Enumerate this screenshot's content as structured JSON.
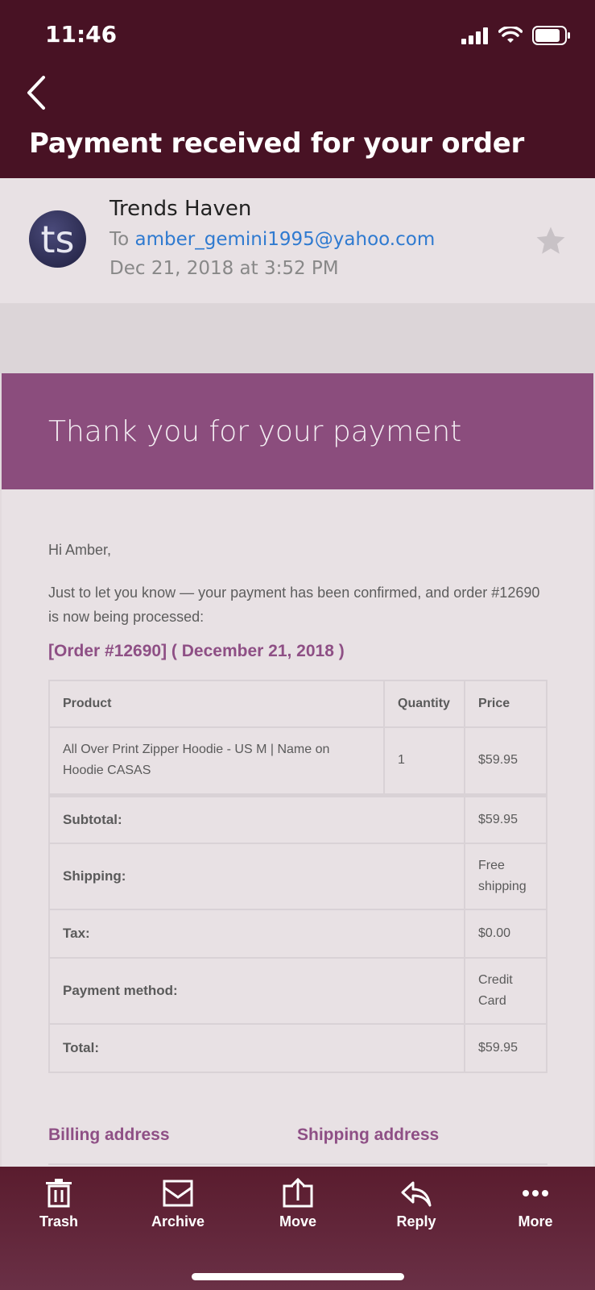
{
  "status": {
    "time": "11:46"
  },
  "nav": {
    "subject": "Payment received for your order"
  },
  "email": {
    "avatar_initials": "ts",
    "sender": "Trends Haven",
    "to_prefix": "To",
    "to_address": "amber_gemini1995@yahoo.com",
    "date": "Dec 21, 2018 at 3:52 PM"
  },
  "body": {
    "banner": "Thank you for your payment",
    "greeting": "Hi Amber,",
    "intro": "Just to let you know — your payment has been confirmed, and order #12690 is now being processed:",
    "order_heading": "[Order #12690] ( December 21, 2018 )",
    "table": {
      "headers": [
        "Product",
        "Quantity",
        "Price"
      ],
      "item": {
        "product": "All Over Print Zipper Hoodie - US M | Name on Hoodie CASAS",
        "quantity": "1",
        "price": "$59.95"
      },
      "totals": [
        {
          "label": "Subtotal:",
          "value": "$59.95"
        },
        {
          "label": "Shipping:",
          "value": "Free shipping"
        },
        {
          "label": "Tax:",
          "value": "$0.00"
        },
        {
          "label": "Payment method:",
          "value": "Credit Card"
        },
        {
          "label": "Total:",
          "value": "$59.95"
        }
      ]
    },
    "billing_heading": "Billing address",
    "shipping_heading": "Shipping address"
  },
  "toolbar": {
    "trash": "Trash",
    "archive": "Archive",
    "move": "Move",
    "reply": "Reply",
    "more": "More"
  },
  "colors": {
    "accent": "#8e4f85",
    "header": "#481224",
    "link": "#2f7ad0"
  }
}
